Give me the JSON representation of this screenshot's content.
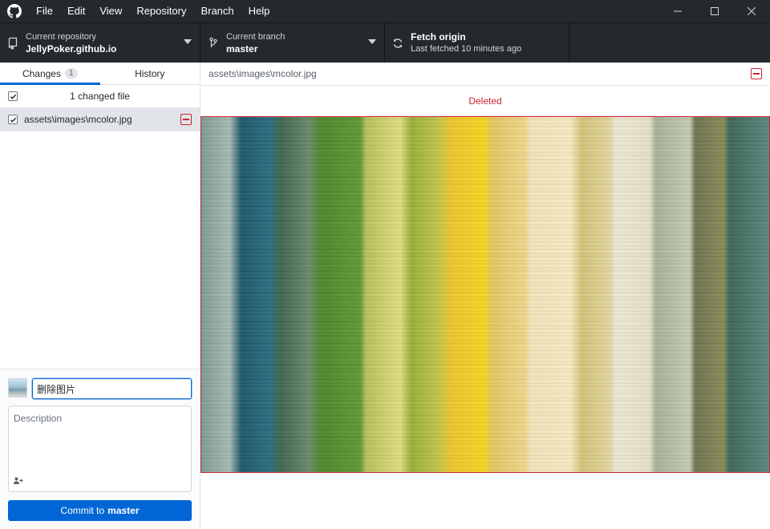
{
  "menu": [
    "File",
    "Edit",
    "View",
    "Repository",
    "Branch",
    "Help"
  ],
  "toolbar": {
    "repo_label": "Current repository",
    "repo_value": "JellyPoker.github.io",
    "branch_label": "Current branch",
    "branch_value": "master",
    "fetch_label": "Fetch origin",
    "fetch_sub": "Last fetched 10 minutes ago"
  },
  "tabs": {
    "changes": "Changes",
    "changes_count": "1",
    "history": "History"
  },
  "changes": {
    "header": "1 changed file",
    "files": [
      {
        "path": "assets\\images\\mcolor.jpg",
        "status": "deleted"
      }
    ]
  },
  "commit": {
    "summary_value": "删除图片",
    "description_placeholder": "Description",
    "button_prefix": "Commit to",
    "button_branch": "master"
  },
  "diff": {
    "path": "assets\\images\\mcolor.jpg",
    "status_label": "Deleted"
  },
  "colors": {
    "accent": "#0366d6",
    "deleted": "#cb2431",
    "titlebar": "#24292e"
  }
}
